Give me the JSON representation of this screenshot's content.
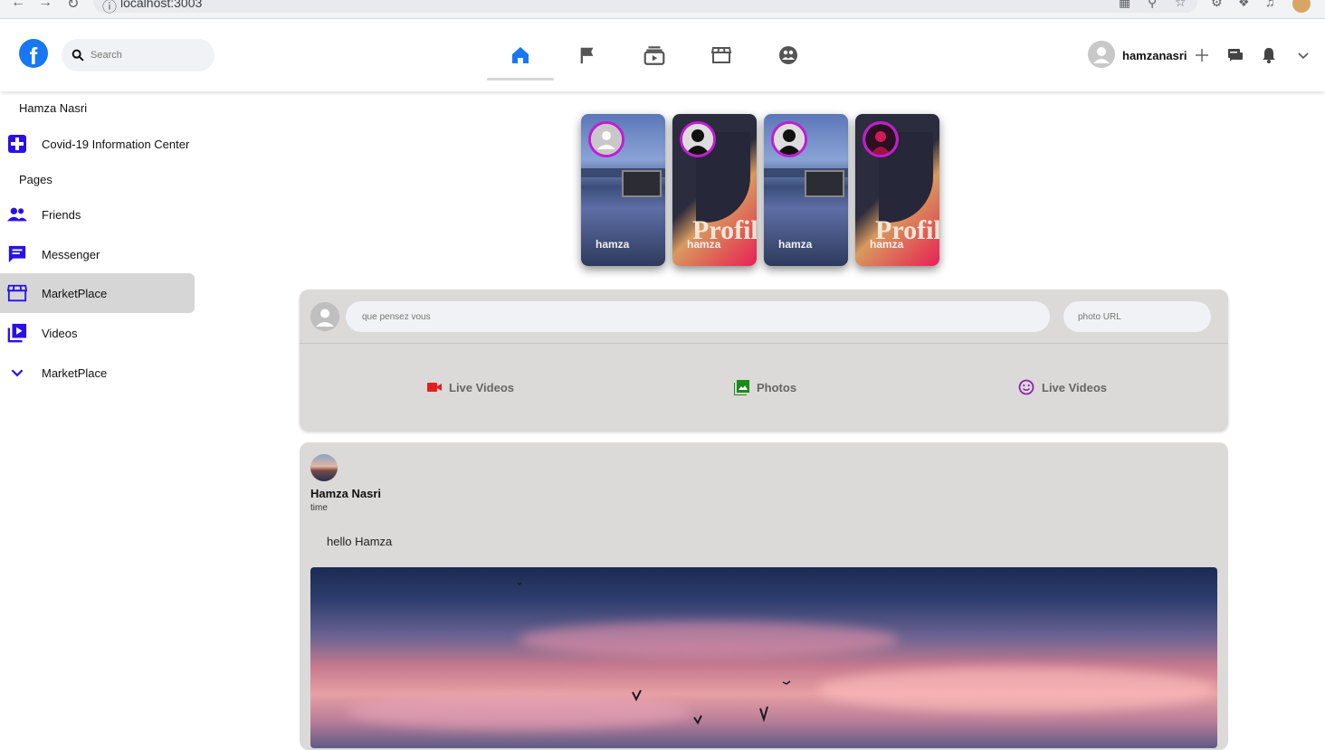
{
  "browser": {
    "url": "localhost:3003"
  },
  "header": {
    "logo_letter": "f",
    "search_placeholder": "Search",
    "username": "hamzanasri",
    "nav_tabs": [
      "home",
      "pages",
      "watch",
      "marketplace",
      "groups"
    ],
    "active_color": "#1877f2"
  },
  "sidebar": {
    "profile_name": "Hamza Nasri",
    "covid_label": "Covid-19 Information Center",
    "pages_heading": "Pages",
    "items": [
      {
        "label": "Friends",
        "icon": "friends-icon"
      },
      {
        "label": "Messenger",
        "icon": "messenger-icon"
      },
      {
        "label": "MarketPlace",
        "icon": "marketplace-icon",
        "active": true
      },
      {
        "label": "Videos",
        "icon": "videos-icon"
      },
      {
        "label": "MarketPlace",
        "icon": "chevron-down-icon"
      }
    ],
    "icon_color": "#2a10e8"
  },
  "stories": [
    {
      "name": "hamza",
      "background": "road"
    },
    {
      "name": "hamza",
      "background": "profile",
      "overlay_text": "Profil"
    },
    {
      "name": "hamza",
      "background": "road"
    },
    {
      "name": "hamza",
      "background": "profile",
      "overlay_text": "Profil"
    }
  ],
  "create_post": {
    "input_placeholder": "que pensez vous",
    "photo_placeholder": "photo URL",
    "options": [
      {
        "label": "Live Videos",
        "icon": "video-camera-icon",
        "color": "#e41e1e"
      },
      {
        "label": "Photos",
        "icon": "photo-library-icon",
        "color": "#1b8a1b"
      },
      {
        "label": "Live Videos",
        "icon": "smiley-icon",
        "color": "#8e24aa"
      }
    ]
  },
  "post": {
    "author": "Hamza Nasri",
    "time": "time",
    "text": "hello Hamza"
  }
}
